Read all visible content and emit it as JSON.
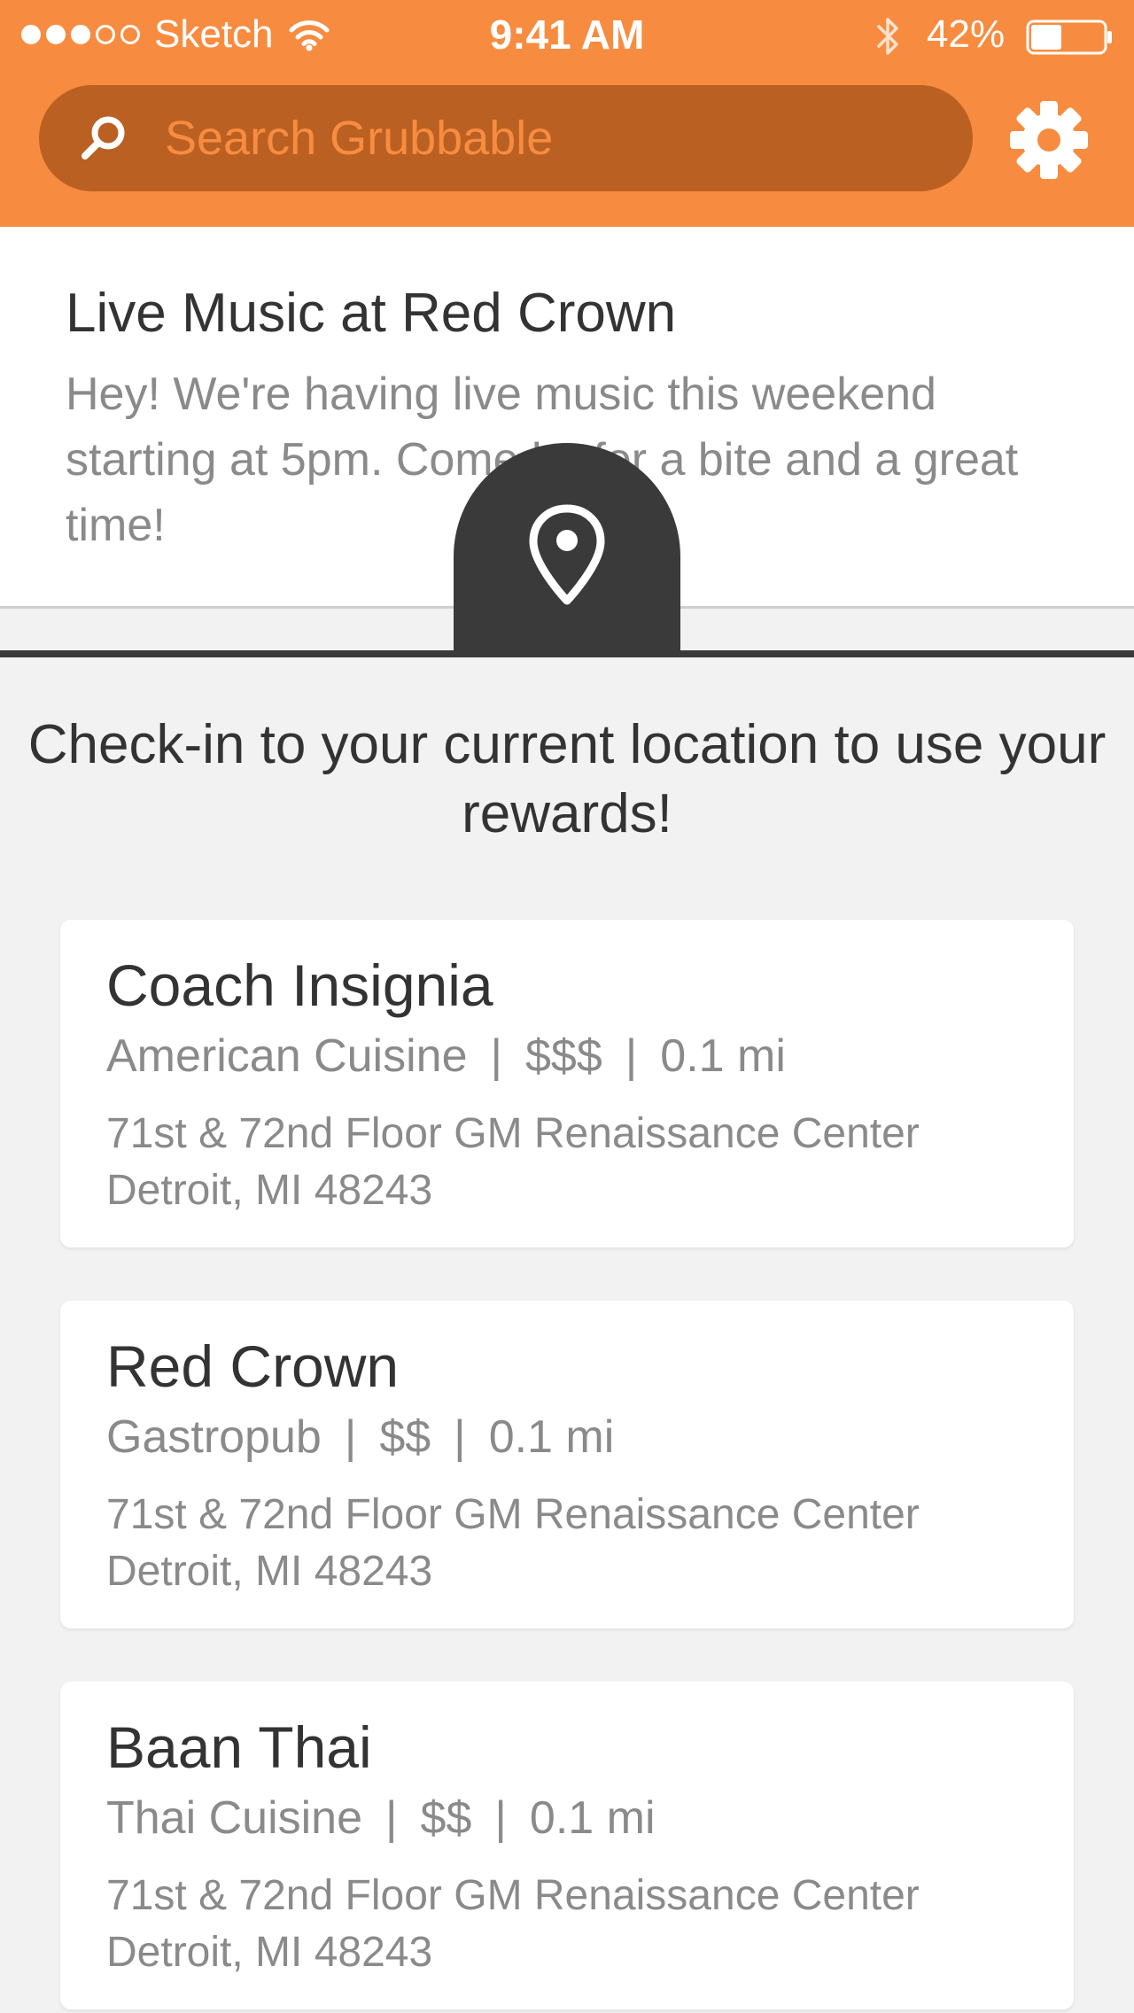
{
  "colors": {
    "header_orange": "#f78c40",
    "search_bar_dark_orange": "#ba6022",
    "dark_gray": "#3a3a3a",
    "text_dark": "#333333",
    "text_gray": "#8a8a8a",
    "background": "#f2f2f2"
  },
  "status_bar": {
    "carrier": "Sketch",
    "time": "9:41 AM",
    "battery_percent": "42%",
    "battery_level": 0.42,
    "signal_bars_filled": 3,
    "signal_bars_total": 5,
    "icons": [
      "wifi-icon",
      "bluetooth-icon",
      "battery-icon"
    ]
  },
  "header": {
    "search_placeholder": "Search Grubbable",
    "icons": [
      "search-icon",
      "gear-icon"
    ]
  },
  "announcement": {
    "title": "Live Music at Red Crown",
    "body": "Hey! We're having live music this weekend starting at 5pm. Come by for a bite and a great time!",
    "icon": "location-pin-icon"
  },
  "checkin_prompt": "Check-in to your current location to use your rewards!",
  "restaurants": [
    {
      "name": "Coach Insignia",
      "cuisine": "American Cuisine",
      "price": "$$$",
      "distance": "0.1 mi",
      "address_line1": "71st & 72nd Floor GM Renaissance Center",
      "address_line2": "Detroit, MI 48243"
    },
    {
      "name": "Red Crown",
      "cuisine": "Gastropub",
      "price": "$$",
      "distance": "0.1 mi",
      "address_line1": "71st & 72nd Floor GM Renaissance Center",
      "address_line2": "Detroit, MI 48243"
    },
    {
      "name": "Baan Thai",
      "cuisine": "Thai Cuisine",
      "price": "$$",
      "distance": "0.1 mi",
      "address_line1": "71st & 72nd Floor GM Renaissance Center",
      "address_line2": "Detroit, MI 48243"
    }
  ],
  "meta_separator": "|"
}
